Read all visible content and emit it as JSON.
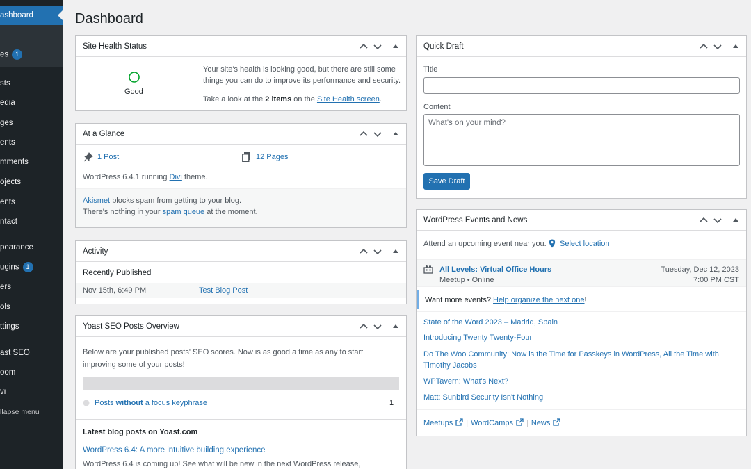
{
  "sidebar": {
    "items": [
      {
        "label": "ashboard"
      },
      {
        "label": "es",
        "badge": "1"
      },
      {
        "label": "sts"
      },
      {
        "label": "edia"
      },
      {
        "label": "ges"
      },
      {
        "label": "ents"
      },
      {
        "label": "mments"
      },
      {
        "label": "ojects"
      },
      {
        "label": "ents"
      },
      {
        "label": "ntact"
      },
      {
        "label": "pearance"
      },
      {
        "label": "ugins",
        "badge": "1"
      },
      {
        "label": "ers"
      },
      {
        "label": "ols"
      },
      {
        "label": "ttings"
      },
      {
        "label": "ast SEO"
      },
      {
        "label": "oom"
      },
      {
        "label": "vi"
      },
      {
        "label": "llapse menu"
      }
    ]
  },
  "page": {
    "title": "Dashboard"
  },
  "site_health": {
    "title": "Site Health Status",
    "status": "Good",
    "message": "Your site's health is looking good, but there are still some things you can do to improve its performance and security.",
    "take_look_prefix": "Take a look at the",
    "items_count": "2 items",
    "on_the": "on the",
    "link": "Site Health screen",
    "period": "."
  },
  "at_a_glance": {
    "title": "At a Glance",
    "posts": "1 Post",
    "pages": "12 Pages",
    "running_prefix": "WordPress 6.4.1 running",
    "theme": "Divi",
    "running_suffix": "theme.",
    "akismet": "Akismet",
    "akismet_text": "blocks spam from getting to your blog.",
    "spam_prefix": "There's nothing in your",
    "spam_link": "spam queue",
    "spam_suffix": "at the moment."
  },
  "activity": {
    "title": "Activity",
    "recently_published": "Recently Published",
    "items": [
      {
        "date": "Nov 15th, 6:49 PM",
        "title": "Test Blog Post"
      }
    ]
  },
  "yoast": {
    "title": "Yoast SEO Posts Overview",
    "intro": "Below are your published posts' SEO scores. Now is as good a time as any to start improving some of your posts!",
    "row_prefix": "Posts",
    "row_bold": "without",
    "row_suffix": "a focus keyphrase",
    "row_count": "1",
    "latest_heading": "Latest blog posts on Yoast.com",
    "post_title": "WordPress 6.4: A more intuitive building experience",
    "post_excerpt": "WordPress 6.4 is coming up! See what will be new in the next WordPress release,"
  },
  "quick_draft": {
    "title": "Quick Draft",
    "title_label": "Title",
    "title_value": "",
    "content_label": "Content",
    "content_placeholder": "What's on your mind?",
    "save_label": "Save Draft"
  },
  "events": {
    "title": "WordPress Events and News",
    "attend": "Attend an upcoming event near you.",
    "select_location": "Select location",
    "event": {
      "name": "All Levels: Virtual Office Hours",
      "meta": "Meetup • Online",
      "date": "Tuesday, Dec 12, 2023",
      "time": "7:00 PM CST"
    },
    "more_prefix": "Want more events?",
    "more_link": "Help organize the next one",
    "more_suffix": "!",
    "news": [
      {
        "title": "State of the Word 2023 – Madrid, Spain"
      },
      {
        "title": "Introducing Twenty Twenty-Four"
      },
      {
        "title": "Do The Woo Community: Now is the Time for Passkeys in WordPress, All the Time with Timothy Jacobs"
      },
      {
        "title": "WPTavern: What's Next?"
      },
      {
        "title": "Matt: Sunbird Security Isn't Nothing"
      }
    ],
    "footer": {
      "meetups": "Meetups",
      "sep": "|",
      "wordcamps": "WordCamps",
      "news": "News"
    }
  },
  "colors": {
    "accent": "#2271b1",
    "sidebar": "#1d2327",
    "good": "#00a32a"
  }
}
